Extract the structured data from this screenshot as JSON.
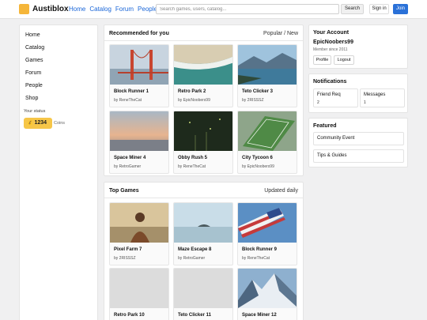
{
  "header": {
    "brand": "Austiblox",
    "nav": [
      "Home",
      "Catalog",
      "Forum",
      "People"
    ],
    "search_placeholder": "Search games, users, catalog...",
    "search_button": "Search",
    "signin_button": "Sign in",
    "join_button": "Join"
  },
  "sidebar": {
    "items": [
      "Home",
      "Catalog",
      "Games",
      "Forum",
      "People",
      "Shop"
    ],
    "status_label": "Your status",
    "coins_icon": "coin-icon",
    "coins_value": "1234",
    "coins_label": "Coins"
  },
  "recommended": {
    "title": "Recommended for you",
    "meta": "Popular / New",
    "cards": [
      {
        "title": "Block Runner 1",
        "by": "by ReneTheCat",
        "image": "bridge"
      },
      {
        "title": "Retro Park 2",
        "by": "by EpicNoobers99",
        "image": "beach"
      },
      {
        "title": "Teto Clicker 3",
        "by": "by 2RISSSZ",
        "image": "lake"
      },
      {
        "title": "Space Miner 4",
        "by": "by RetroGamer",
        "image": "dawn"
      },
      {
        "title": "Obby Rush 5",
        "by": "by ReneTheCat",
        "image": "forest"
      },
      {
        "title": "City Tycoon 6",
        "by": "by EpicNoobers99",
        "image": "field"
      }
    ]
  },
  "top_games": {
    "title": "Top Games",
    "meta": "Updated daily",
    "cards": [
      {
        "title": "Pixel Farm 7",
        "by": "by 2RISSSZ",
        "image": "person"
      },
      {
        "title": "Maze Escape 8",
        "by": "by RetroGamer",
        "image": "island"
      },
      {
        "title": "Block Runner 9",
        "by": "by ReneTheCat",
        "image": "flag"
      },
      {
        "title": "Retro Park 10",
        "by": "",
        "image": "blank"
      },
      {
        "title": "Teto Clicker 11",
        "by": "",
        "image": "blank"
      },
      {
        "title": "Space Miner 12",
        "by": "",
        "image": "mountain"
      }
    ]
  },
  "account": {
    "title": "Your Account",
    "username": "EpicNoobers99",
    "member_since": "Member since 2011",
    "profile_button": "Profile",
    "logout_button": "Logout"
  },
  "notifications": {
    "title": "Notifications",
    "friend_label": "Friend Req",
    "friend_count": "2",
    "messages_label": "Messages",
    "messages_count": "1"
  },
  "featured": {
    "title": "Featured",
    "items": [
      "Community Event",
      "Tips & Guides"
    ]
  }
}
